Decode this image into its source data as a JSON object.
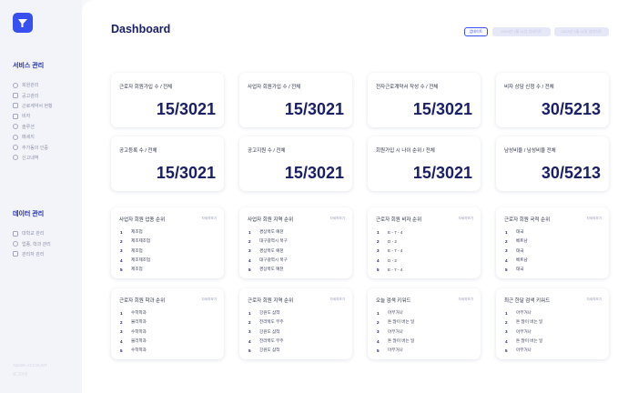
{
  "colors": {
    "accent": "#3a4ff0",
    "navy": "#1b2066"
  },
  "sidebar": {
    "section1_title": "서비스 관리",
    "section1_items": [
      "회원관리",
      "공고관리",
      "근로계약서 현황",
      "비자",
      "솔루션",
      "메세지",
      "추가동의 인증",
      "신고내역"
    ],
    "section2_title": "데이터 관리",
    "section2_items": [
      "대학교 관리",
      "업종, 학과 관리",
      "관리자 관리"
    ],
    "footer": [
      "ADMIN ACCOUNT",
      "로그아웃"
    ]
  },
  "header": {
    "title": "Dashboard",
    "tab_active": "업데이트",
    "tab_2": "2023년 3월 31일 업데이트",
    "tab_3": "2023년 3월 31일 업데이트"
  },
  "stats": [
    {
      "label": "근로자 회원가입 수 / 전체",
      "value": "15/3021"
    },
    {
      "label": "사업자 회원가입 수 / 전체",
      "value": "15/3021"
    },
    {
      "label": "전자근로계약서 작성 수 / 전체",
      "value": "15/3021"
    },
    {
      "label": "비자 상담 신청 수 / 전체",
      "value": "30/5213"
    },
    {
      "label": "공고등록 수 / 전체",
      "value": "15/3021"
    },
    {
      "label": "공고지원 수 / 전체",
      "value": "15/3021"
    },
    {
      "label": "회원가입 시 나이 순위 / 전체",
      "value": "15/3021"
    },
    {
      "label": "남성비율 / 남성비율 전체",
      "value": "30/5213"
    }
  ],
  "rankings": [
    {
      "title": "사업자 회원 업종 순위",
      "more": "자세히보기",
      "items": [
        "제조업",
        "제조제조업",
        "제조업",
        "제조제조업",
        "제조업"
      ]
    },
    {
      "title": "사업자 회원 지역 순위",
      "more": "자세히보기",
      "items": [
        "경상북도 예천",
        "대구광역시 북구",
        "경상북도 예천",
        "대구광역시 북구",
        "경상북도 예천"
      ]
    },
    {
      "title": "근로자 회원 비자 순위",
      "more": "자세히보기",
      "items": [
        "E - 7 - 4",
        "D - 2",
        "E - 7 - 4",
        "D - 2",
        "E - 7 - 4"
      ]
    },
    {
      "title": "근로자 회원 국적 순위",
      "more": "자세히보기",
      "items": [
        "태국",
        "베트남",
        "태국",
        "베트남",
        "태국"
      ]
    },
    {
      "title": "근로자 회원 학과 순위",
      "more": "자세히보기",
      "items": [
        "수학학과",
        "물리학과",
        "수학학과",
        "물리학과",
        "수학학과"
      ]
    },
    {
      "title": "근로자 회원 지역 순위",
      "more": "자세히보기",
      "items": [
        "강원도 삼척",
        "전라북도 무주",
        "강원도 삼척",
        "전라북도 무주",
        "강원도 삼척"
      ]
    },
    {
      "title": "오늘 검색 키워드",
      "more": "자세히보기",
      "items": [
        "아무거나",
        "돈 많이 버는 일",
        "아무거나",
        "돈 많이 버는 일",
        "아무거나"
      ]
    },
    {
      "title": "최근 한달 검색 키워드",
      "more": "자세히보기",
      "items": [
        "아무거나",
        "돈 많이 버는 일",
        "아무거나",
        "돈 많이 버는 일",
        "아무거나"
      ]
    }
  ]
}
